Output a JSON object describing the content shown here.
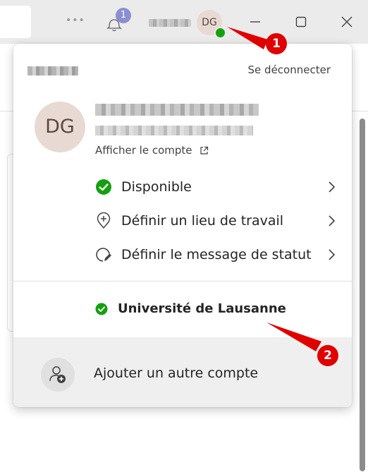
{
  "titlebar": {
    "notification_badge": "1",
    "avatar_initials": "DG",
    "presence_color": "#13a10e"
  },
  "popup": {
    "sign_out_label": "Se déconnecter",
    "avatar_initials": "DG",
    "view_account_label": "Afficher le compte",
    "menu": [
      {
        "label": "Disponible",
        "icon": "available-check-icon"
      },
      {
        "label": "Définir un lieu de travail",
        "icon": "location-add-icon"
      },
      {
        "label": "Définir le message de statut",
        "icon": "status-message-icon"
      }
    ],
    "tenant_label": "Université de Lausanne",
    "add_account_label": "Ajouter un autre compte"
  },
  "callouts": [
    {
      "number": "1"
    },
    {
      "number": "2"
    }
  ],
  "colors": {
    "accent_green": "#13a10e",
    "callout_red": "#e00000",
    "avatar_bg": "#e8d9d3"
  }
}
